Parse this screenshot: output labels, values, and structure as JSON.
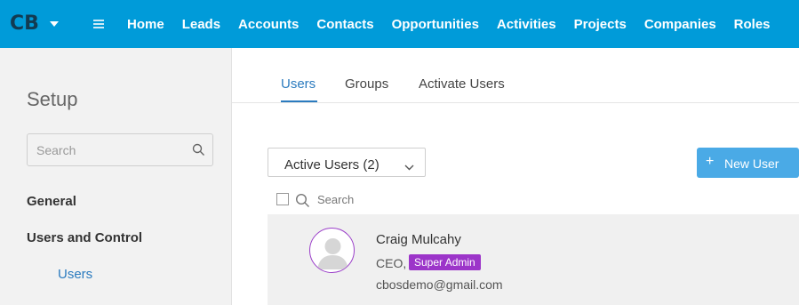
{
  "app": {
    "logo_text": "CB"
  },
  "nav": {
    "items": [
      "Home",
      "Leads",
      "Accounts",
      "Contacts",
      "Opportunities",
      "Activities",
      "Projects",
      "Companies",
      "Roles"
    ]
  },
  "sidebar": {
    "title": "Setup",
    "search_placeholder": "Search",
    "items": [
      {
        "label": "General"
      },
      {
        "label": "Users and Control"
      }
    ],
    "sub_items": [
      {
        "label": "Users"
      }
    ]
  },
  "tabs": [
    {
      "label": "Users",
      "active": true
    },
    {
      "label": "Groups",
      "active": false
    },
    {
      "label": "Activate Users",
      "active": false
    }
  ],
  "filter": {
    "selected": "Active Users (2)"
  },
  "new_user_button": {
    "label": "New User"
  },
  "list": {
    "search_placeholder": "Search",
    "users": [
      {
        "name": "Craig Mulcahy",
        "role": "CEO,",
        "badge": "Super Admin",
        "email": "cbosdemo@gmail.com"
      }
    ]
  },
  "colors": {
    "nav_bg": "#009bd9",
    "accent_blue": "#2b7bbf",
    "button_blue": "#4aaae6",
    "badge_purple": "#9c35c9"
  }
}
